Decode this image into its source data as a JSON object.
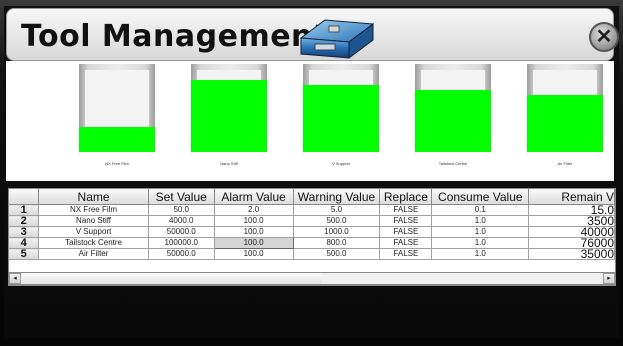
{
  "header": {
    "title": "Tool Management",
    "toolbox_icon": "toolbox-icon",
    "close_icon": "close-icon",
    "close_glyph": "✕"
  },
  "bins": [
    {
      "label": "NX Free Film",
      "fill_fraction": 0.3
    },
    {
      "label": "Nano Stiff",
      "fill_fraction": 0.88
    },
    {
      "label": "V Support",
      "fill_fraction": 0.82
    },
    {
      "label": "Tailstock Centre",
      "fill_fraction": 0.76
    },
    {
      "label": "Air Filter",
      "fill_fraction": 0.7
    }
  ],
  "table": {
    "columns": [
      "",
      "Name",
      "Set Value",
      "Alarm Value",
      "Warning Value",
      "Replace",
      "Consume Value",
      "Remain V"
    ],
    "rows": [
      {
        "num": "1",
        "name": "NX Free Film",
        "set": "50.0",
        "alarm": "2.0",
        "warning": "5.0",
        "replace": "FALSE",
        "consume": "0.1",
        "remain": "15.0"
      },
      {
        "num": "2",
        "name": "Nano Stiff",
        "set": "4000.0",
        "alarm": "100.0",
        "warning": "500.0",
        "replace": "FALSE",
        "consume": "1.0",
        "remain": "3500"
      },
      {
        "num": "3",
        "name": "V Support",
        "set": "50000.0",
        "alarm": "100.0",
        "warning": "1000.0",
        "replace": "FALSE",
        "consume": "1.0",
        "remain": "40000"
      },
      {
        "num": "4",
        "name": "Tailstock Centre",
        "set": "100000.0",
        "alarm": "100.0",
        "warning": "800.0",
        "replace": "FALSE",
        "consume": "1.0",
        "remain": "76000"
      },
      {
        "num": "5",
        "name": "Air Filter",
        "set": "50000.0",
        "alarm": "100.0",
        "warning": "500.0",
        "replace": "FALSE",
        "consume": "1.0",
        "remain": "35000"
      }
    ]
  },
  "scrollbar": {
    "left_glyph": "◂",
    "right_glyph": "▸"
  },
  "colors": {
    "fill": "#00ff00",
    "header_bg": "#e6e6e6",
    "background": "#0a0a0a"
  }
}
